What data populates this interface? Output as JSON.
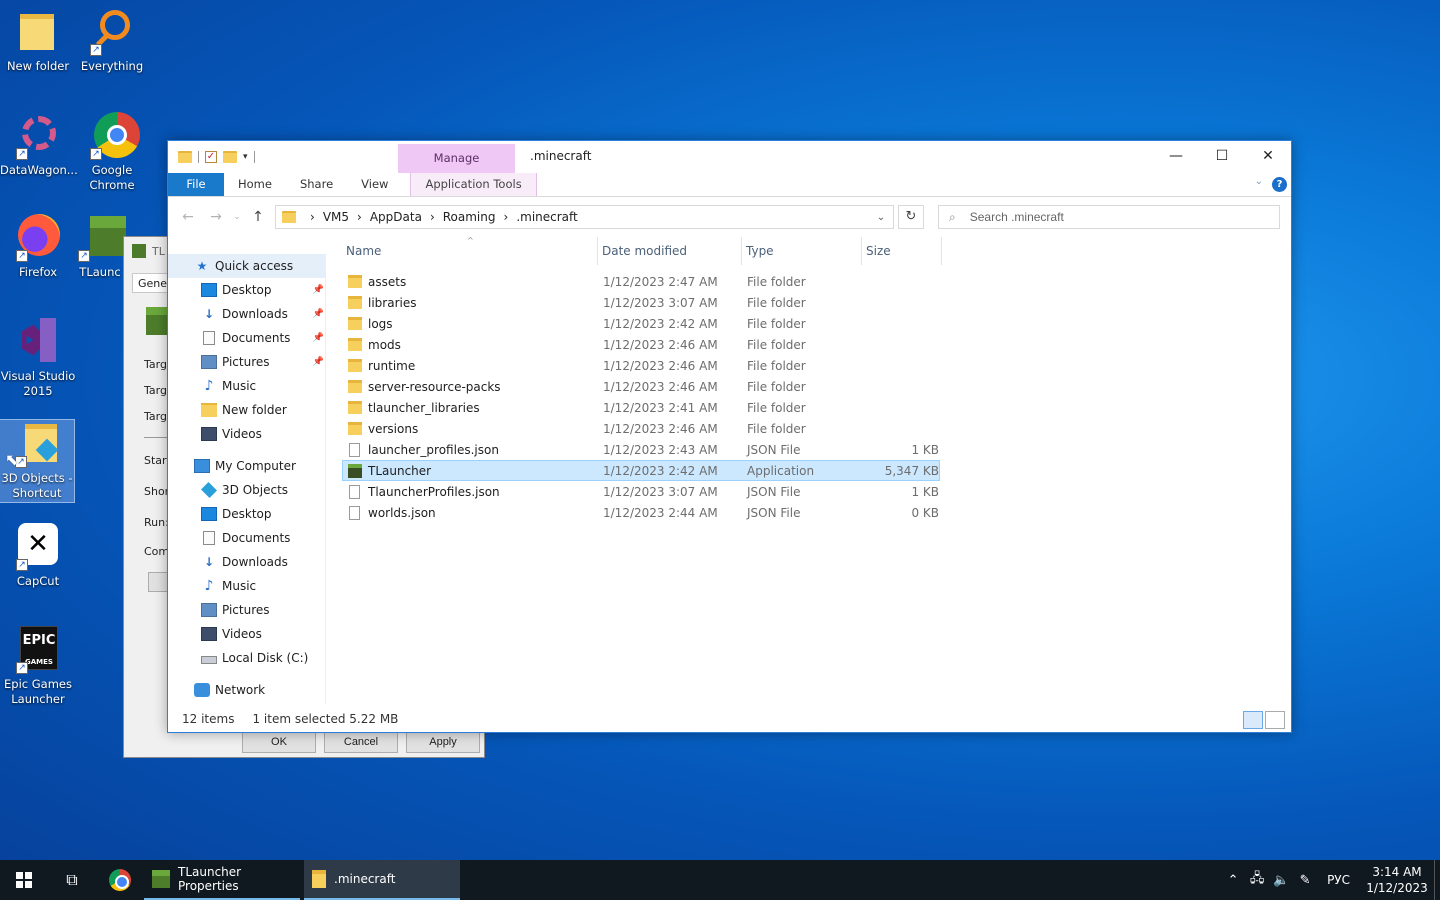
{
  "colors": {
    "accent": "#1979ca",
    "manage_tab": "#f0c8f5",
    "selection": "#cce8ff",
    "taskbar": "#101820"
  },
  "desktop": {
    "icons": [
      {
        "label": "New folder",
        "icon": "folder-icon"
      },
      {
        "label": "Everything",
        "icon": "magnifier-icon"
      },
      {
        "label": "DataWagon...",
        "icon": "gear-icon"
      },
      {
        "label": "Google Chrome",
        "icon": "chrome-icon"
      },
      {
        "label": "Firefox",
        "icon": "firefox-icon"
      },
      {
        "label": "TLaunc",
        "icon": "minecraft-icon"
      },
      {
        "label": "Visual Studio 2015",
        "icon": "visual-studio-icon"
      },
      {
        "label": "3D Objects - Shortcut",
        "icon": "folder-icon"
      },
      {
        "label": "CapCut",
        "icon": "capcut-icon"
      },
      {
        "label": "Epic Games Launcher",
        "icon": "epic-games-icon"
      }
    ]
  },
  "properties_dialog": {
    "title": "TL",
    "tab": "Gener",
    "labels": [
      "Targ",
      "Targ",
      "Targ",
      "Start",
      "Shor",
      "Run:",
      "Comi"
    ],
    "ok": "OK",
    "cancel": "Cancel",
    "apply": "Apply"
  },
  "explorer": {
    "title": ".minecraft",
    "manage": "Manage",
    "ribbon_tabs": [
      "File",
      "Home",
      "Share",
      "View"
    ],
    "app_tools": "Application Tools",
    "breadcrumb": [
      "VM5",
      "AppData",
      "Roaming",
      ".minecraft"
    ],
    "search_placeholder": "Search .minecraft",
    "nav": {
      "quick_access": "Quick access",
      "quick_items": [
        "Desktop",
        "Downloads",
        "Documents",
        "Pictures",
        "Music",
        "New folder",
        "Videos"
      ],
      "my_computer": "My Computer",
      "computer_items": [
        "3D Objects",
        "Desktop",
        "Documents",
        "Downloads",
        "Music",
        "Pictures",
        "Videos",
        "Local Disk (C:)"
      ],
      "network": "Network"
    },
    "columns": {
      "name": "Name",
      "date": "Date modified",
      "type": "Type",
      "size": "Size"
    },
    "files": [
      {
        "name": "assets",
        "date": "1/12/2023 2:47 AM",
        "type": "File folder",
        "size": "",
        "kind": "folder"
      },
      {
        "name": "libraries",
        "date": "1/12/2023 3:07 AM",
        "type": "File folder",
        "size": "",
        "kind": "folder"
      },
      {
        "name": "logs",
        "date": "1/12/2023 2:42 AM",
        "type": "File folder",
        "size": "",
        "kind": "folder"
      },
      {
        "name": "mods",
        "date": "1/12/2023 2:46 AM",
        "type": "File folder",
        "size": "",
        "kind": "folder"
      },
      {
        "name": "runtime",
        "date": "1/12/2023 2:46 AM",
        "type": "File folder",
        "size": "",
        "kind": "folder"
      },
      {
        "name": "server-resource-packs",
        "date": "1/12/2023 2:46 AM",
        "type": "File folder",
        "size": "",
        "kind": "folder"
      },
      {
        "name": "tlauncher_libraries",
        "date": "1/12/2023 2:41 AM",
        "type": "File folder",
        "size": "",
        "kind": "folder"
      },
      {
        "name": "versions",
        "date": "1/12/2023 2:46 AM",
        "type": "File folder",
        "size": "",
        "kind": "folder"
      },
      {
        "name": "launcher_profiles.json",
        "date": "1/12/2023 2:43 AM",
        "type": "JSON File",
        "size": "1 KB",
        "kind": "json"
      },
      {
        "name": "TLauncher",
        "date": "1/12/2023 2:42 AM",
        "type": "Application",
        "size": "5,347 KB",
        "kind": "app",
        "selected": true
      },
      {
        "name": "TlauncherProfiles.json",
        "date": "1/12/2023 3:07 AM",
        "type": "JSON File",
        "size": "1 KB",
        "kind": "json"
      },
      {
        "name": "worlds.json",
        "date": "1/12/2023 2:44 AM",
        "type": "JSON File",
        "size": "0 KB",
        "kind": "json"
      }
    ],
    "status": {
      "items": "12 items",
      "selected": "1 item selected  5.22 MB"
    }
  },
  "taskbar": {
    "apps": [
      {
        "label": "TLauncher Properties"
      },
      {
        "label": ".minecraft"
      }
    ],
    "lang": "РУС",
    "time": "3:14 AM",
    "date": "1/12/2023"
  }
}
